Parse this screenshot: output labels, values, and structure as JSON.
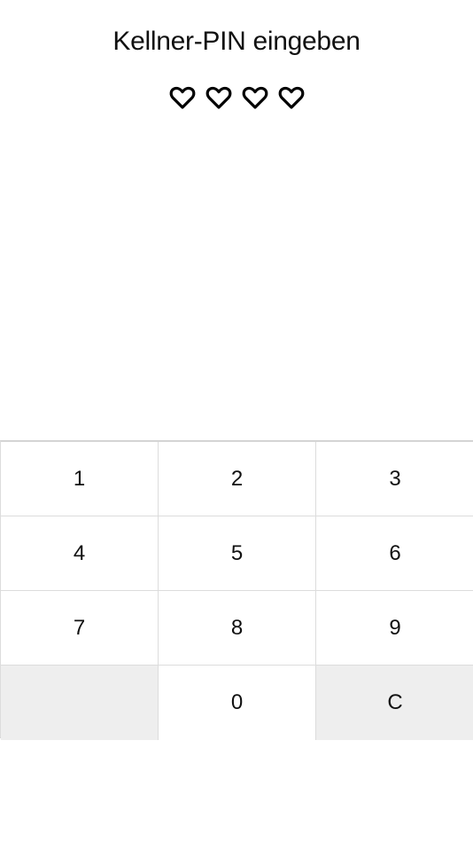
{
  "header": {
    "title": "Kellner-PIN eingeben"
  },
  "pin": {
    "length": 4,
    "entered": 0,
    "icon": "heart-outline-icon"
  },
  "keypad": {
    "keys": [
      {
        "label": "1"
      },
      {
        "label": "2"
      },
      {
        "label": "3"
      },
      {
        "label": "4"
      },
      {
        "label": "5"
      },
      {
        "label": "6"
      },
      {
        "label": "7"
      },
      {
        "label": "8"
      },
      {
        "label": "9"
      },
      {
        "label": ""
      },
      {
        "label": "0"
      },
      {
        "label": "C"
      }
    ],
    "colors": {
      "key_background": "#ffffff",
      "shaded_background": "#eeeeee",
      "border": "#dcdcdc"
    }
  }
}
